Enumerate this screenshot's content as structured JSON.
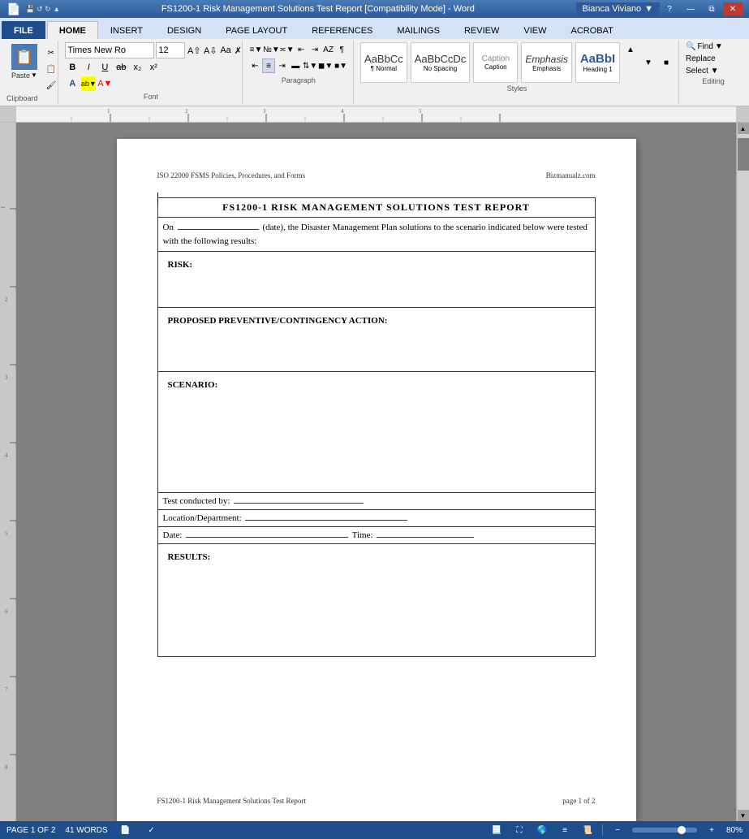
{
  "titlebar": {
    "title": "FS1200-1 Risk Management Solutions Test Report [Compatibility Mode] - Word",
    "help_btn": "?",
    "minimize_btn": "—",
    "restore_btn": "❐",
    "close_btn": "✕"
  },
  "tabs": [
    {
      "label": "FILE",
      "active": false
    },
    {
      "label": "HOME",
      "active": true
    },
    {
      "label": "INSERT",
      "active": false
    },
    {
      "label": "DESIGN",
      "active": false
    },
    {
      "label": "PAGE LAYOUT",
      "active": false
    },
    {
      "label": "REFERENCES",
      "active": false
    },
    {
      "label": "MAILINGS",
      "active": false
    },
    {
      "label": "REVIEW",
      "active": false
    },
    {
      "label": "VIEW",
      "active": false
    },
    {
      "label": "ACROBAT",
      "active": false
    }
  ],
  "ribbon": {
    "clipboard": {
      "paste_label": "Paste",
      "section_label": "Clipboard"
    },
    "font": {
      "font_name": "Times New Ro",
      "font_size": "12",
      "section_label": "Font",
      "bold": "B",
      "italic": "I",
      "underline": "U",
      "strikethrough": "abc",
      "subscript": "x₂",
      "superscript": "x²"
    },
    "paragraph": {
      "section_label": "Paragraph"
    },
    "styles": {
      "section_label": "Styles",
      "items": [
        {
          "name": "Caption",
          "preview": "Caption"
        },
        {
          "name": "Emphasis",
          "preview": "Emphasis"
        },
        {
          "name": "Heading 1",
          "preview": "AaBbI"
        }
      ]
    },
    "editing": {
      "find_label": "Find",
      "replace_label": "Replace",
      "select_label": "Select ▼",
      "section_label": "Editing"
    }
  },
  "user": {
    "name": "Bianca Viviano"
  },
  "document": {
    "header_left": "ISO 22000 FSMS Policies, Procedures, and Forms",
    "header_right": "Bizmanualz.com",
    "title": "FS1200-1 RISK MANAGEMENT SOLUTIONS TEST REPORT",
    "intro": "On ___________________ (date), the Disaster Management Plan solutions to the scenario indicated below were tested with the following results:",
    "risk_label": "RISK:",
    "proposed_label": "PROPOSED PREVENTIVE/CONTINGENCY ACTION:",
    "scenario_label": "SCENARIO:",
    "test_conducted_label": "Test conducted by:",
    "location_label": "Location/Department:",
    "date_label": "Date:",
    "time_label": "Time:",
    "results_label": "RESULTS:",
    "footer_left": "FS1200-1 Risk Management Solutions Test Report",
    "footer_right": "page 1 of 2"
  },
  "statusbar": {
    "page_info": "PAGE 1 OF 2",
    "word_count": "41 WORDS",
    "zoom": "80%"
  }
}
